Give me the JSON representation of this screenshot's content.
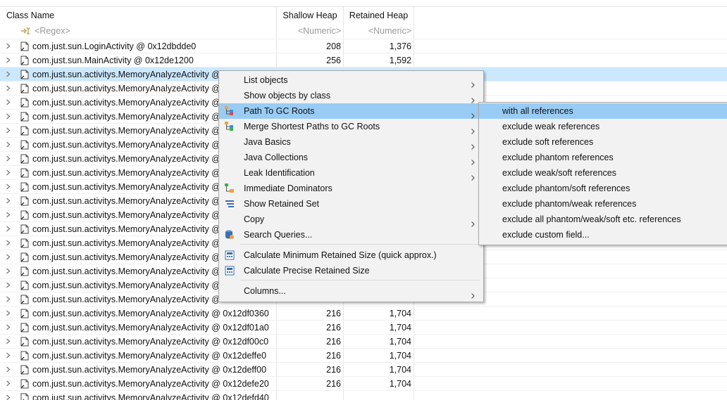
{
  "columns": {
    "class_name": "Class Name",
    "shallow_heap": "Shallow Heap",
    "retained_heap": "Retained Heap"
  },
  "filters": {
    "class_name": "<Regex>",
    "shallow_heap": "<Numeric>",
    "retained_heap": "<Numeric>"
  },
  "rows": [
    {
      "name": "com.just.sun.LoginActivity @ 0x12dbdde0",
      "shallow": "208",
      "retained": "1,376"
    },
    {
      "name": "com.just.sun.MainActivity @ 0x12de1200",
      "shallow": "256",
      "retained": "1,592"
    },
    {
      "name": "com.just.sun.activitys.MemoryAnalyzeActivity @",
      "shallow": "",
      "retained": ""
    },
    {
      "name": "com.just.sun.activitys.MemoryAnalyzeActivity @",
      "shallow": "",
      "retained": ""
    },
    {
      "name": "com.just.sun.activitys.MemoryAnalyzeActivity @",
      "shallow": "",
      "retained": ""
    },
    {
      "name": "com.just.sun.activitys.MemoryAnalyzeActivity @",
      "shallow": "",
      "retained": ""
    },
    {
      "name": "com.just.sun.activitys.MemoryAnalyzeActivity @",
      "shallow": "",
      "retained": ""
    },
    {
      "name": "com.just.sun.activitys.MemoryAnalyzeActivity @",
      "shallow": "",
      "retained": ""
    },
    {
      "name": "com.just.sun.activitys.MemoryAnalyzeActivity @",
      "shallow": "",
      "retained": ""
    },
    {
      "name": "com.just.sun.activitys.MemoryAnalyzeActivity @",
      "shallow": "",
      "retained": ""
    },
    {
      "name": "com.just.sun.activitys.MemoryAnalyzeActivity @",
      "shallow": "",
      "retained": ""
    },
    {
      "name": "com.just.sun.activitys.MemoryAnalyzeActivity @",
      "shallow": "",
      "retained": ""
    },
    {
      "name": "com.just.sun.activitys.MemoryAnalyzeActivity @",
      "shallow": "",
      "retained": ""
    },
    {
      "name": "com.just.sun.activitys.MemoryAnalyzeActivity @",
      "shallow": "",
      "retained": ""
    },
    {
      "name": "com.just.sun.activitys.MemoryAnalyzeActivity @",
      "shallow": "",
      "retained": ""
    },
    {
      "name": "com.just.sun.activitys.MemoryAnalyzeActivity @",
      "shallow": "",
      "retained": ""
    },
    {
      "name": "com.just.sun.activitys.MemoryAnalyzeActivity @",
      "shallow": "",
      "retained": ""
    },
    {
      "name": "com.just.sun.activitys.MemoryAnalyzeActivity @",
      "shallow": "",
      "retained": ""
    },
    {
      "name": "com.just.sun.activitys.MemoryAnalyzeActivity @",
      "shallow": "",
      "retained": ""
    },
    {
      "name": "com.just.sun.activitys.MemoryAnalyzeActivity @ 0x12df0360",
      "shallow": "216",
      "retained": "1,704"
    },
    {
      "name": "com.just.sun.activitys.MemoryAnalyzeActivity @ 0x12df01a0",
      "shallow": "216",
      "retained": "1,704"
    },
    {
      "name": "com.just.sun.activitys.MemoryAnalyzeActivity @ 0x12df00c0",
      "shallow": "216",
      "retained": "1,704"
    },
    {
      "name": "com.just.sun.activitys.MemoryAnalyzeActivity @ 0x12deffe0",
      "shallow": "216",
      "retained": "1,704"
    },
    {
      "name": "com.just.sun.activitys.MemoryAnalyzeActivity @ 0x12deff00",
      "shallow": "216",
      "retained": "1,704"
    },
    {
      "name": "com.just.sun.activitys.MemoryAnalyzeActivity @ 0x12defe20",
      "shallow": "216",
      "retained": "1,704"
    },
    {
      "name": "com.just.sun.activitys.MemoryAnalyzeActivity @ 0x12defd40",
      "shallow": "",
      "retained": ""
    }
  ],
  "selected_row_index": 2,
  "context_menu": {
    "items": [
      {
        "label": "List objects",
        "submenu": true
      },
      {
        "label": "Show objects by class",
        "submenu": true
      },
      {
        "label": "Path To GC Roots",
        "submenu": true
      },
      {
        "label": "Merge Shortest Paths to GC Roots",
        "submenu": true
      },
      {
        "label": "Java Basics",
        "submenu": true
      },
      {
        "label": "Java Collections",
        "submenu": true
      },
      {
        "label": "Leak Identification",
        "submenu": true
      },
      {
        "label": "Immediate Dominators",
        "submenu": false
      },
      {
        "label": "Show Retained Set",
        "submenu": false
      },
      {
        "label": "Copy",
        "submenu": true
      },
      {
        "label": "Search Queries...",
        "submenu": false
      },
      {
        "label": "Calculate Minimum Retained Size (quick approx.)",
        "submenu": false
      },
      {
        "label": "Calculate Precise Retained Size",
        "submenu": false
      },
      {
        "label": "Columns...",
        "submenu": true
      }
    ]
  },
  "submenu": {
    "items": [
      {
        "label": "with all references"
      },
      {
        "label": "exclude weak references"
      },
      {
        "label": "exclude soft references"
      },
      {
        "label": "exclude phantom references"
      },
      {
        "label": "exclude weak/soft references"
      },
      {
        "label": "exclude phantom/soft references"
      },
      {
        "label": "exclude phantom/weak references"
      },
      {
        "label": "exclude all phantom/weak/soft etc. references"
      },
      {
        "label": "exclude custom field..."
      }
    ]
  },
  "colors": {
    "selection": "#cce8ff",
    "menu_highlight": "#99ccf5",
    "menu_bg": "#f2f2f2"
  }
}
